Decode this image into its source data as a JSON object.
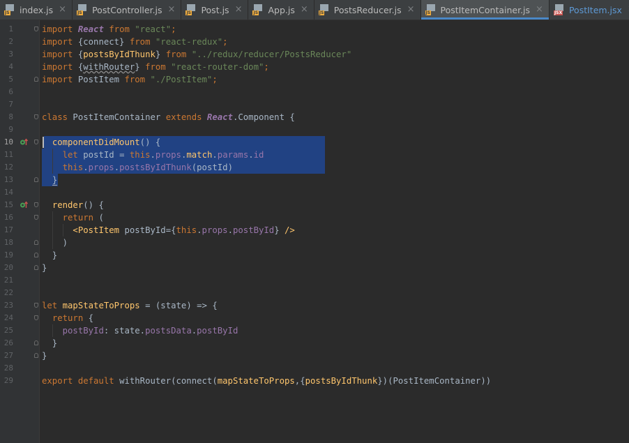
{
  "tabs": [
    {
      "label": "index.js",
      "icon": "js",
      "active": false
    },
    {
      "label": "PostController.js",
      "icon": "js",
      "active": false
    },
    {
      "label": "Post.js",
      "icon": "js",
      "active": false
    },
    {
      "label": "App.js",
      "icon": "js",
      "active": false
    },
    {
      "label": "PostsReducer.js",
      "icon": "js",
      "active": false
    },
    {
      "label": "PostItemContainer.js",
      "icon": "js",
      "active": true
    },
    {
      "label": "PostItem.jsx",
      "icon": "jsx",
      "active": false
    }
  ],
  "icons": {
    "js_badge": "JS",
    "jsx_badge": "JSX",
    "close_glyph": "×",
    "override_icon": "override-method-icon"
  },
  "colors": {
    "background": "#2b2b2b",
    "gutter": "#313335",
    "selection": "#214283",
    "keyword": "#cc7832",
    "string": "#6a8759",
    "function": "#ffc66d",
    "property": "#9876aa",
    "text": "#a9b7c6",
    "tab_active_underline": "#4a88c7"
  },
  "editor": {
    "current_line": 10,
    "lines": [
      {
        "n": "1",
        "segs": [
          [
            "kw",
            "import "
          ],
          [
            "cls",
            "React"
          ],
          [
            "kw",
            " from "
          ],
          [
            "str",
            "\"react\""
          ],
          [
            "kw",
            ";"
          ]
        ]
      },
      {
        "n": "2",
        "segs": [
          [
            "kw",
            "import "
          ],
          [
            "pl",
            "{connect}"
          ],
          [
            "kw",
            " from "
          ],
          [
            "str",
            "\"react-redux\""
          ],
          [
            "kw",
            ";"
          ]
        ]
      },
      {
        "n": "3",
        "segs": [
          [
            "kw",
            "import "
          ],
          [
            "pl",
            "{"
          ],
          [
            "fn",
            "postsByIdThunk"
          ],
          [
            "pl",
            "}"
          ],
          [
            "kw",
            " from "
          ],
          [
            "str",
            "\"../redux/reducer/PostsReducer\""
          ]
        ]
      },
      {
        "n": "4",
        "segs": [
          [
            "kw",
            "import "
          ],
          [
            "pl",
            "{"
          ],
          [
            "ul",
            "withRouter"
          ],
          [
            "pl",
            "}"
          ],
          [
            "kw",
            " from "
          ],
          [
            "str",
            "\"react-router-dom\""
          ],
          [
            "kw",
            ";"
          ]
        ]
      },
      {
        "n": "5",
        "segs": [
          [
            "kw",
            "import "
          ],
          [
            "pl",
            "PostItem"
          ],
          [
            "kw",
            " from "
          ],
          [
            "str",
            "\"./PostItem\""
          ],
          [
            "kw",
            ";"
          ]
        ]
      },
      {
        "n": "6",
        "segs": []
      },
      {
        "n": "7",
        "segs": []
      },
      {
        "n": "8",
        "segs": [
          [
            "kw",
            "class "
          ],
          [
            "pl",
            "PostItemContainer "
          ],
          [
            "kw",
            "extends "
          ],
          [
            "cls",
            "React"
          ],
          [
            "pl",
            ".Component {"
          ]
        ]
      },
      {
        "n": "9",
        "segs": []
      },
      {
        "n": "10",
        "segs": [
          [
            "pl",
            "  "
          ],
          [
            "fn",
            "componentDidMount"
          ],
          [
            "pl",
            "() {"
          ]
        ]
      },
      {
        "n": "11",
        "segs": [
          [
            "pl",
            "    "
          ],
          [
            "kw",
            "let "
          ],
          [
            "pl",
            "postId = "
          ],
          [
            "kw",
            "this"
          ],
          [
            "pl",
            "."
          ],
          [
            "prop",
            "props"
          ],
          [
            "pl",
            "."
          ],
          [
            "fn",
            "match"
          ],
          [
            "pl",
            "."
          ],
          [
            "prop",
            "params"
          ],
          [
            "pl",
            "."
          ],
          [
            "prop",
            "id"
          ]
        ]
      },
      {
        "n": "12",
        "segs": [
          [
            "pl",
            "    "
          ],
          [
            "kw",
            "this"
          ],
          [
            "pl",
            "."
          ],
          [
            "prop",
            "props"
          ],
          [
            "pl",
            "."
          ],
          [
            "prop",
            "postsByIdThunk"
          ],
          [
            "pl",
            "(postId)"
          ]
        ]
      },
      {
        "n": "13",
        "segs": [
          [
            "pl",
            "  }"
          ]
        ]
      },
      {
        "n": "14",
        "segs": []
      },
      {
        "n": "15",
        "segs": [
          [
            "pl",
            "  "
          ],
          [
            "fn",
            "render"
          ],
          [
            "pl",
            "() {"
          ]
        ]
      },
      {
        "n": "16",
        "segs": [
          [
            "pl",
            "    "
          ],
          [
            "kw",
            "return "
          ],
          [
            "pl",
            "("
          ]
        ]
      },
      {
        "n": "17",
        "segs": [
          [
            "pl",
            "      "
          ],
          [
            "fn",
            "<PostItem "
          ],
          [
            "pl",
            "postById="
          ],
          [
            "pl",
            "{"
          ],
          [
            "kw",
            "this"
          ],
          [
            "pl",
            "."
          ],
          [
            "prop",
            "props"
          ],
          [
            "pl",
            "."
          ],
          [
            "prop",
            "postById"
          ],
          [
            "pl",
            "} "
          ],
          [
            "fn",
            "/>"
          ]
        ]
      },
      {
        "n": "18",
        "segs": [
          [
            "pl",
            "    )"
          ]
        ]
      },
      {
        "n": "19",
        "segs": [
          [
            "pl",
            "  }"
          ]
        ]
      },
      {
        "n": "20",
        "segs": [
          [
            "pl",
            "}"
          ]
        ]
      },
      {
        "n": "21",
        "segs": []
      },
      {
        "n": "22",
        "segs": []
      },
      {
        "n": "23",
        "segs": [
          [
            "kw",
            "let "
          ],
          [
            "fn",
            "mapStateToProps"
          ],
          [
            "pl",
            " = (state) => {"
          ]
        ]
      },
      {
        "n": "24",
        "segs": [
          [
            "pl",
            "  "
          ],
          [
            "kw",
            "return "
          ],
          [
            "pl",
            "{"
          ]
        ]
      },
      {
        "n": "25",
        "segs": [
          [
            "pl",
            "    "
          ],
          [
            "prop",
            "postById"
          ],
          [
            "pl",
            ": state."
          ],
          [
            "prop",
            "postsData"
          ],
          [
            "pl",
            "."
          ],
          [
            "prop",
            "postById"
          ]
        ]
      },
      {
        "n": "26",
        "segs": [
          [
            "pl",
            "  }"
          ]
        ]
      },
      {
        "n": "27",
        "segs": [
          [
            "pl",
            "}"
          ]
        ]
      },
      {
        "n": "28",
        "segs": []
      },
      {
        "n": "29",
        "segs": [
          [
            "kw",
            "export default "
          ],
          [
            "pl",
            "withRouter(connect("
          ],
          [
            "fn",
            "mapStateToProps"
          ],
          [
            "pl",
            ",{"
          ],
          [
            "fn",
            "postsByIdThunk"
          ],
          [
            "pl",
            "})(PostItemContainer))"
          ]
        ]
      }
    ]
  }
}
